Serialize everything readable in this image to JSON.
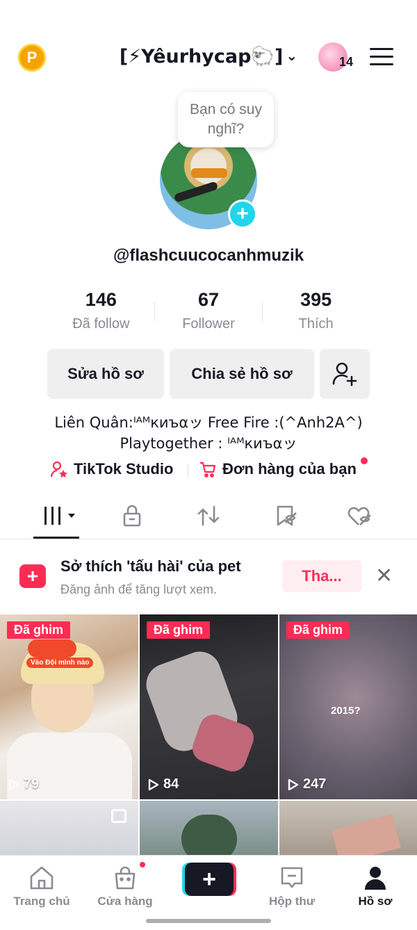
{
  "header": {
    "coin_label": "P",
    "username": "[⚡Yêurhycap🐑]",
    "friends_count": "14"
  },
  "profile": {
    "thought_prompt": "Bạn có suy nghĩ?",
    "handle": "@flashcuucocanhmuzik",
    "stats": [
      {
        "value": "146",
        "label": "Đã follow"
      },
      {
        "value": "67",
        "label": "Follower"
      },
      {
        "value": "395",
        "label": "Thích"
      }
    ],
    "edit_button": "Sửa hồ sơ",
    "share_button": "Chia sẻ hồ sơ",
    "bio_line1": "Liên Quân:ᴵᴬᴹкиъαッ Free Fire :(^Anh2A^)",
    "bio_line2": "Playtogether : ᴵᴬᴹкиъαッ",
    "studio_link": "TikTok Studio",
    "orders_link": "Đơn hàng của bạn"
  },
  "tabs": [
    "videos-icon",
    "lock-icon",
    "repost-icon",
    "favorites-icon",
    "liked-icon"
  ],
  "banner": {
    "title": "Sở thích 'tấu hài' của pet",
    "subtitle": "Đăng ảnh để tăng lượt xem.",
    "cta": "Tha..."
  },
  "videos": [
    {
      "pinned": "Đã ghim",
      "views": "79",
      "overlay": "Vào Đội mình nào"
    },
    {
      "pinned": "Đã ghim",
      "views": "84",
      "overlay": ""
    },
    {
      "pinned": "Đã ghim",
      "views": "247",
      "overlay": "2015?"
    }
  ],
  "nav": {
    "home": "Trang chủ",
    "shop": "Cửa hàng",
    "create": "+",
    "inbox": "Hộp thư",
    "profile": "Hồ sơ"
  },
  "colors": {
    "accent": "#fe2c55",
    "cyan": "#20d5ec",
    "text": "#161823",
    "muted": "#8a8b91"
  }
}
